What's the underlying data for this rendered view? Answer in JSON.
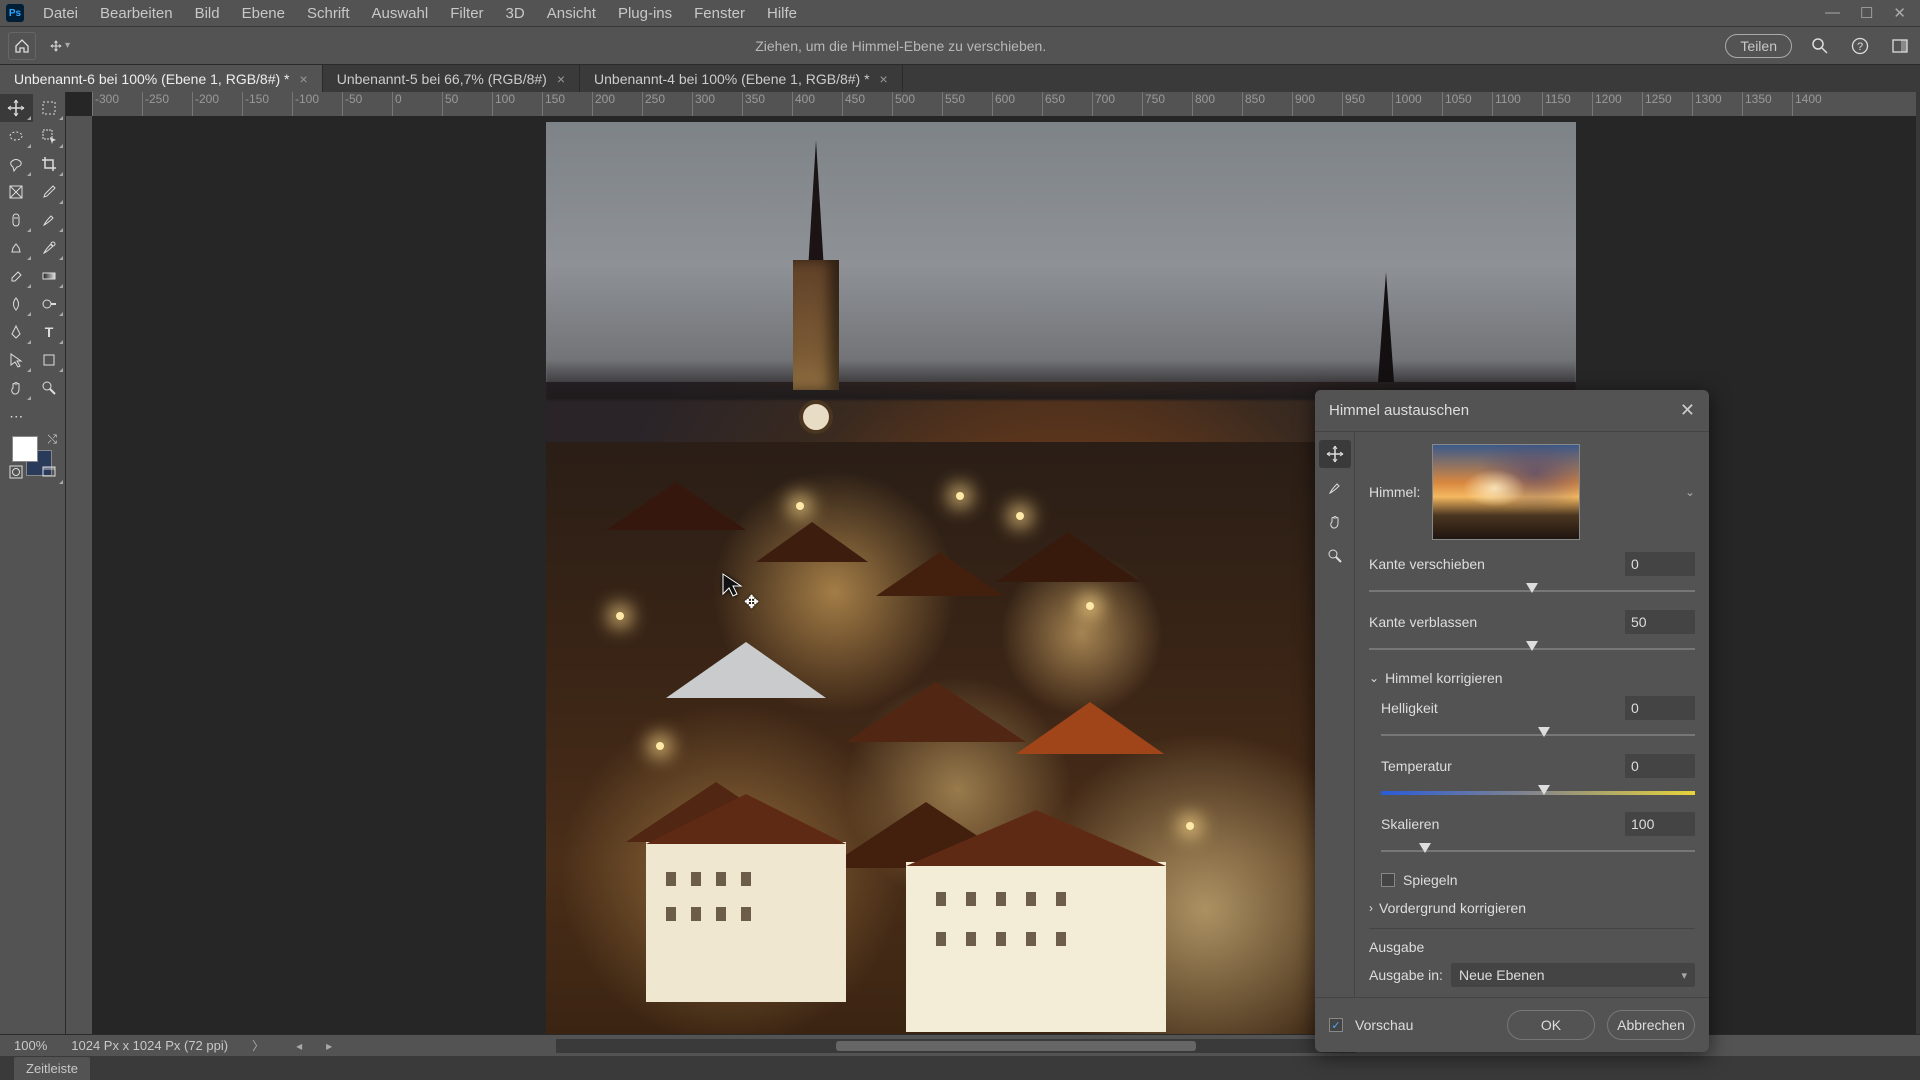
{
  "menu": [
    "Datei",
    "Bearbeiten",
    "Bild",
    "Ebene",
    "Schrift",
    "Auswahl",
    "Filter",
    "3D",
    "Ansicht",
    "Plug-ins",
    "Fenster",
    "Hilfe"
  ],
  "optionsbar": {
    "hint": "Ziehen, um die Himmel-Ebene zu verschieben.",
    "share": "Teilen"
  },
  "tabs": [
    {
      "label": "Unbenannt-6 bei 100% (Ebene 1, RGB/8#) *",
      "active": true
    },
    {
      "label": "Unbenannt-5 bei 66,7% (RGB/8#)",
      "active": false
    },
    {
      "label": "Unbenannt-4 bei 100% (Ebene 1, RGB/8#) *",
      "active": false
    }
  ],
  "ruler_marks": [
    "-300",
    "-250",
    "-200",
    "-150",
    "-100",
    "-50",
    "0",
    "50",
    "100",
    "150",
    "200",
    "250",
    "300",
    "350",
    "400",
    "450",
    "500",
    "550",
    "600",
    "650",
    "700",
    "750",
    "800",
    "850",
    "900",
    "950",
    "1000",
    "1050",
    "1100",
    "1150",
    "1200",
    "1250",
    "1300",
    "1350",
    "1400"
  ],
  "status": {
    "zoom": "100%",
    "dims": "1024 Px x 1024 Px (72 ppi)"
  },
  "timeline": {
    "label": "Zeitleiste"
  },
  "dialog": {
    "title": "Himmel austauschen",
    "sky_label": "Himmel:",
    "edge_shift": {
      "label": "Kante verschieben",
      "value": "0",
      "pos": 50
    },
    "edge_fade": {
      "label": "Kante verblassen",
      "value": "50",
      "pos": 50
    },
    "sky_adjust_hdr": "Himmel korrigieren",
    "brightness": {
      "label": "Helligkeit",
      "value": "0",
      "pos": 52
    },
    "temperature": {
      "label": "Temperatur",
      "value": "0",
      "pos": 52
    },
    "scale": {
      "label": "Skalieren",
      "value": "100",
      "pos": 14
    },
    "flip": "Spiegeln",
    "fg_adjust_hdr": "Vordergrund korrigieren",
    "output_hdr": "Ausgabe",
    "output_to_label": "Ausgabe in:",
    "output_to_value": "Neue Ebenen",
    "preview": "Vorschau",
    "ok": "OK",
    "cancel": "Abbrechen"
  }
}
